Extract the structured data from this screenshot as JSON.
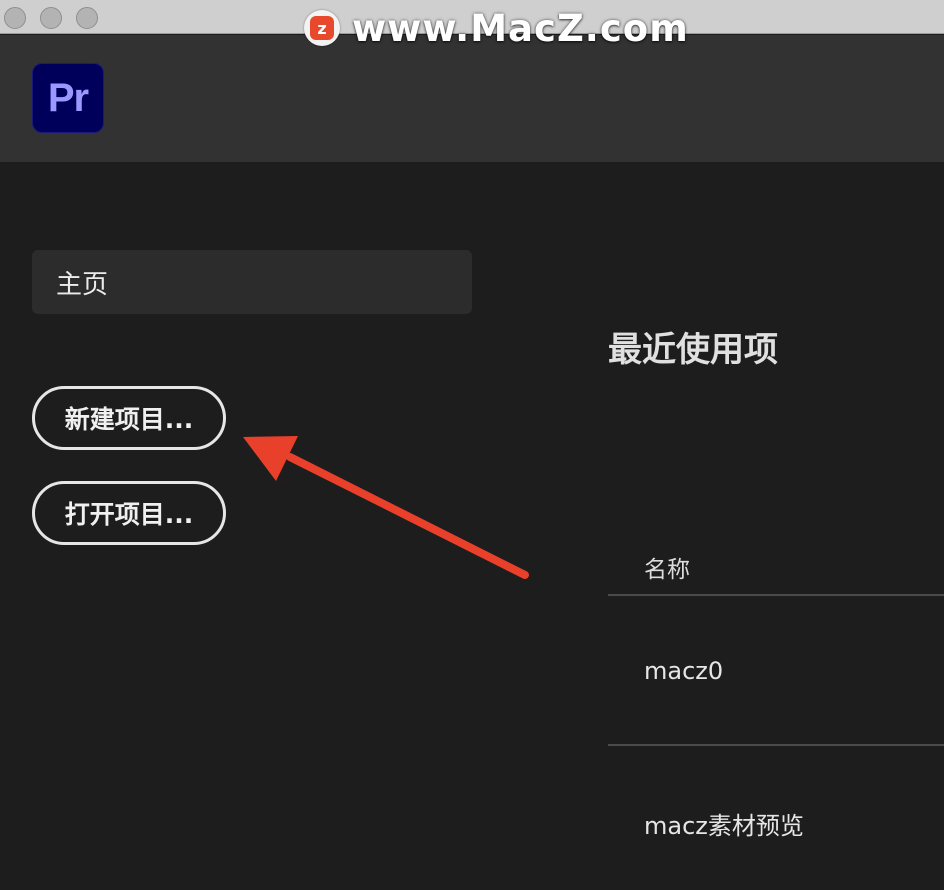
{
  "watermark": {
    "logo_letter": "z",
    "text": "www.MacZ.com"
  },
  "app": {
    "icon_text": "Pr",
    "icon_color": "#00005b",
    "icon_text_color": "#9999ff"
  },
  "sidebar": {
    "home_label": "主页",
    "new_project_label": "新建项目...",
    "open_project_label": "打开项目..."
  },
  "recent": {
    "title": "最近使用项",
    "column_name": "名称",
    "items": [
      {
        "name": "macz0"
      },
      {
        "name": "macz素材预览"
      }
    ]
  },
  "annotation": {
    "arrow_color": "#e8402a"
  }
}
